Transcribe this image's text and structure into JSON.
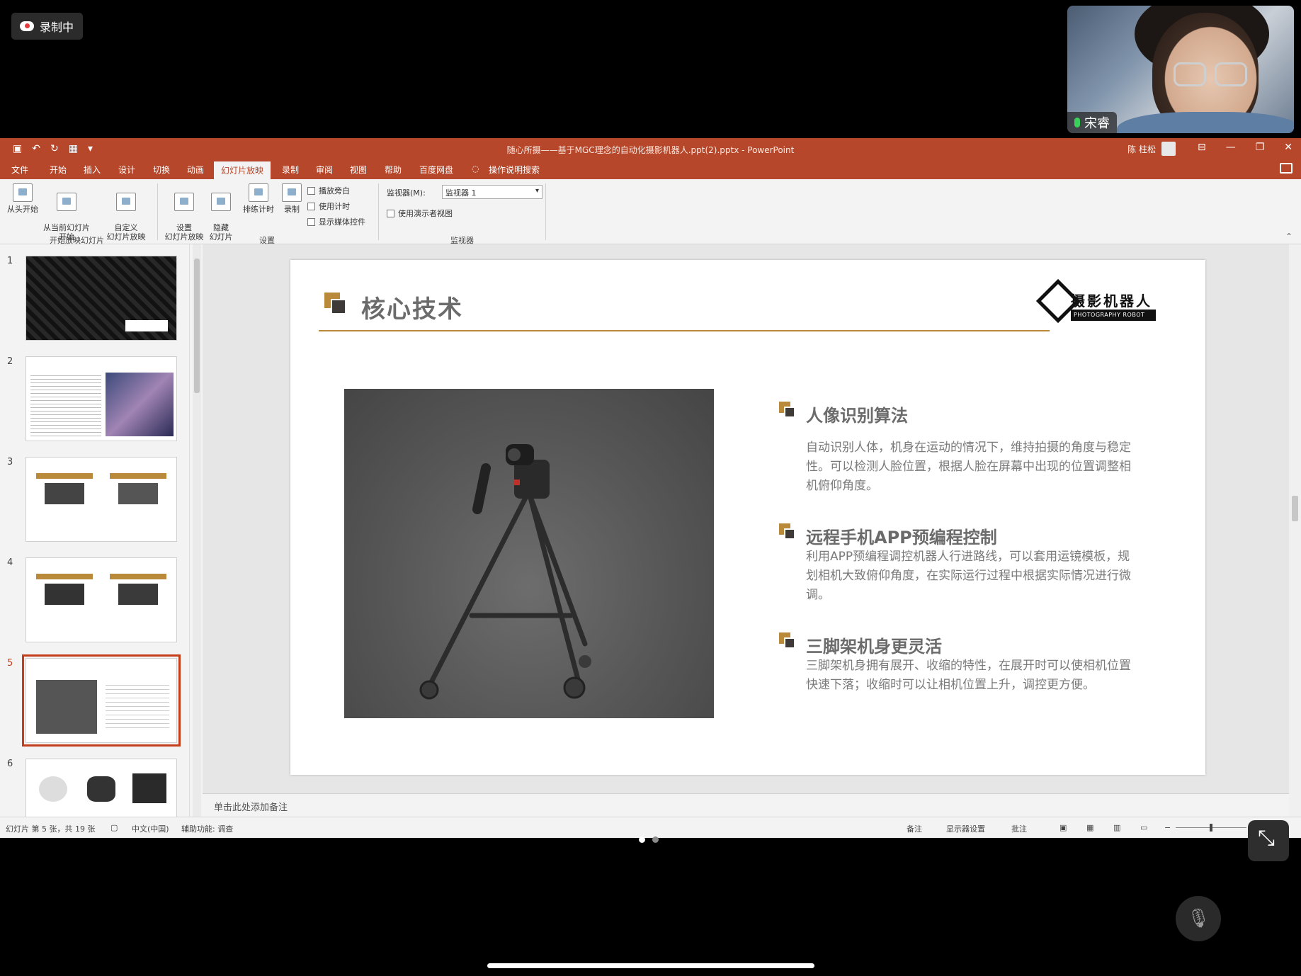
{
  "recording": {
    "label": "录制中"
  },
  "webcam": {
    "name": "宋睿"
  },
  "window": {
    "title": "随心所摄——基于MGC理念的自动化摄影机器人.ppt(2).pptx  -  PowerPoint",
    "user": "陈 柱松",
    "controls": [
      "⊟",
      "—",
      "❐",
      "✕"
    ]
  },
  "tabs": [
    "文件",
    "开始",
    "插入",
    "设计",
    "切换",
    "动画",
    "幻灯片放映",
    "录制",
    "审阅",
    "视图",
    "帮助",
    "百度网盘",
    "操作说明搜索"
  ],
  "ribbon": {
    "from_start": "从头开始",
    "from_current": "从当前幻灯片\n开始",
    "custom": "自定义\n幻灯片放映",
    "group_start": "开始放映幻灯片",
    "setup": "设置\n幻灯片放映",
    "hide": "隐藏\n幻灯片",
    "rehearse": "排练计时",
    "record": "录制",
    "chk_narration": "播放旁白",
    "chk_timing": "使用计时",
    "chk_media": "显示媒体控件",
    "group_setup": "设置",
    "monitor_label": "监视器(M):",
    "monitor_value": "监视器 1",
    "chk_presenter": "使用演示者视图",
    "group_monitor": "监视器"
  },
  "thumbnails": [
    {
      "num": "1"
    },
    {
      "num": "2"
    },
    {
      "num": "3"
    },
    {
      "num": "4"
    },
    {
      "num": "5"
    },
    {
      "num": "6"
    }
  ],
  "slide": {
    "title": "核心技术",
    "logo_text": "摄影机器人",
    "logo_sub": "PHOTOGRAPHY ROBOT",
    "features": [
      {
        "title": "人像识别算法",
        "body": "自动识别人体，机身在运动的情况下，维持拍摄的角度与稳定性。可以检测人脸位置，根据人脸在屏幕中出现的位置调整相机俯仰角度。"
      },
      {
        "title": "远程手机APP预编程控制",
        "body": "利用APP预编程调控机器人行进路线，可以套用运镜模板，规划相机大致俯仰角度，在实际运行过程中根据实际情况进行微调。"
      },
      {
        "title": "三脚架机身更灵活",
        "body": "三脚架机身拥有展开、收缩的特性，在展开时可以使相机位置快速下落；收缩时可以让相机位置上升，调控更方便。"
      }
    ]
  },
  "notes": {
    "placeholder": "单击此处添加备注"
  },
  "status": {
    "slide_info": "幻灯片 第 5 张，共 19 张",
    "language": "中文(中国)",
    "accessibility": "辅助功能: 调查",
    "notes_btn": "备注",
    "display_btn": "显示器设置",
    "comments_btn": "批注"
  }
}
